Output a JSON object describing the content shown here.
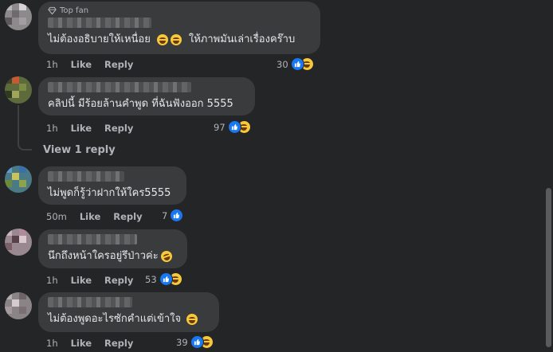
{
  "comments": [
    {
      "badge": "Top fan",
      "text": "ไม่ต้องอธิบายให้เหนื่อย",
      "text2": "ให้ภาพมันเล่าเรื่องคร๊าบ",
      "time": "1h",
      "like": "Like",
      "reply": "Reply",
      "count": "30"
    },
    {
      "text": "คลิปนี้ มีร้อยล้านคำพูด ที่ฉันฟังออก 5555",
      "time": "1h",
      "like": "Like",
      "reply": "Reply",
      "count": "97",
      "view_replies": "View 1 reply"
    },
    {
      "text": "ไม่พูดก็รู้ว่าฝากให้ใคร5555",
      "time": "50m",
      "like": "Like",
      "reply": "Reply",
      "count": "7"
    },
    {
      "text": "นึกถึงหน้าใครอยู่รึป่าวค่ะ",
      "time": "1h",
      "like": "Like",
      "reply": "Reply",
      "count": "53"
    },
    {
      "text": "ไม่ต้องพูดอะไรซักคำแต่เข้าใจ",
      "time": "1h",
      "like": "Like",
      "reply": "Reply",
      "count": "39"
    }
  ],
  "colors": {
    "background": "#242526",
    "bubble": "#3a3b3c",
    "like_reaction": "#1877f2",
    "haha_reaction": "#f7c93a"
  },
  "icons": {
    "badge": "diamond-icon",
    "like": "thumbs-up-icon",
    "haha": "laughing-face-icon"
  }
}
